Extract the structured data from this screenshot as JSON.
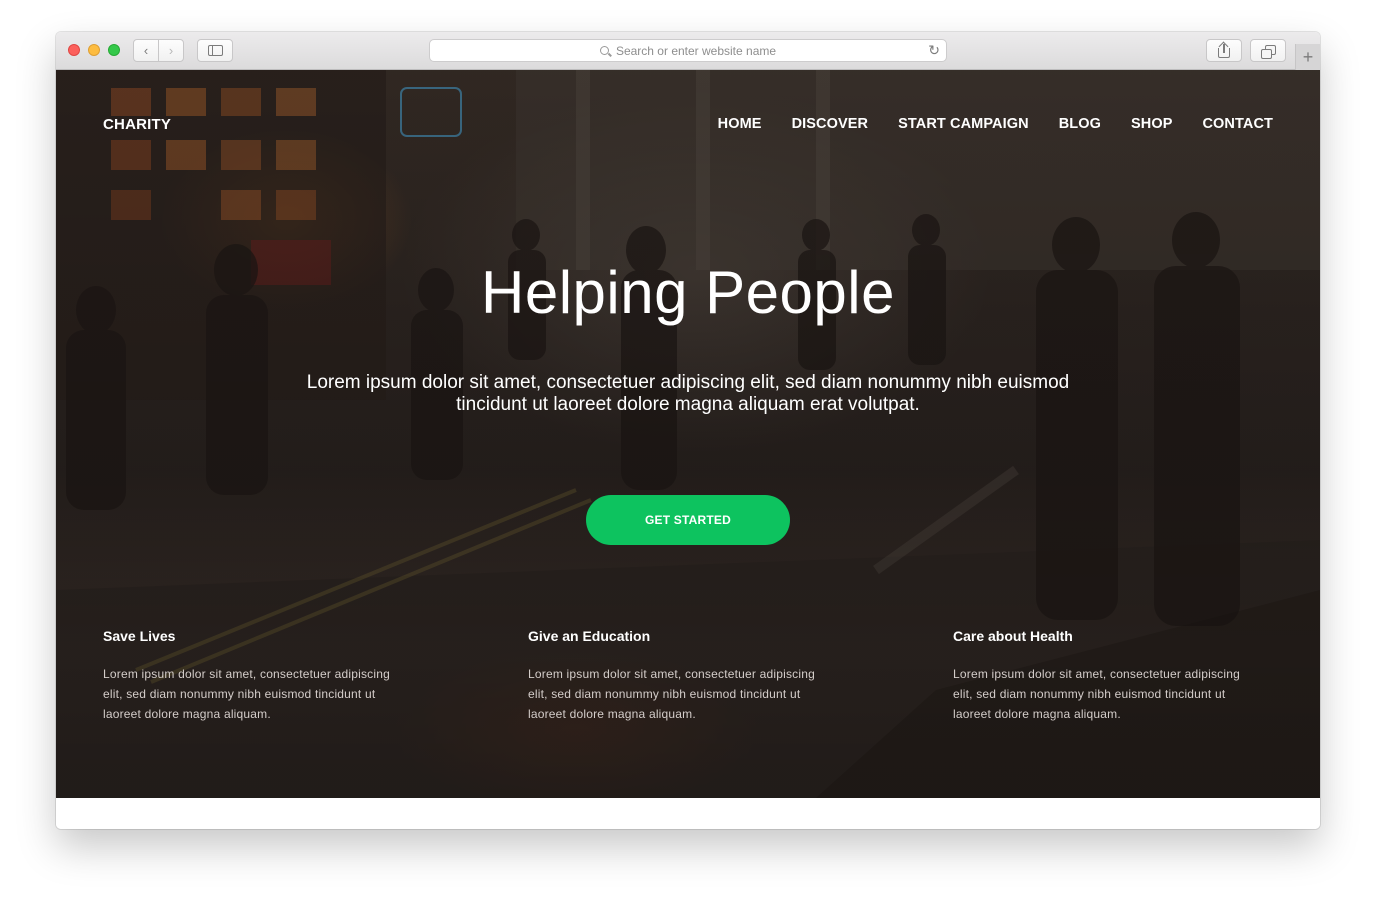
{
  "browser": {
    "address_placeholder": "Search or enter website name",
    "icons": [
      "chevron-left-icon",
      "chevron-right-icon",
      "sidebar-icon",
      "search-icon",
      "reload-icon",
      "share-icon",
      "tabs-icon",
      "plus-icon"
    ]
  },
  "site": {
    "brand": "CHARITY",
    "nav": [
      "HOME",
      "DISCOVER",
      "START CAMPAIGN",
      "BLOG",
      "SHOP",
      "CONTACT"
    ],
    "hero": {
      "title": "Helping People",
      "subtitle": "Lorem ipsum dolor sit amet, consectetuer adipiscing elit, sed diam nonummy nibh euismod tincidunt ut laoreet dolore magna aliquam erat volutpat.",
      "cta": "GET STARTED"
    },
    "features": [
      {
        "title": "Save Lives",
        "text": "Lorem ipsum dolor sit amet, consectetuer adipiscing elit, sed diam nonummy nibh euismod tincidunt ut laoreet dolore magna aliquam."
      },
      {
        "title": "Give an Education",
        "text": "Lorem ipsum dolor sit amet, consectetuer adipiscing elit, sed diam nonummy nibh euismod tincidunt ut laoreet dolore magna aliquam."
      },
      {
        "title": "Care about Health",
        "text": "Lorem ipsum dolor sit amet, consectetuer adipiscing elit, sed diam nonummy nibh euismod tincidunt ut laoreet dolore magna aliquam."
      }
    ]
  },
  "colors": {
    "cta_green": "#0dc35f",
    "traffic_red": "#fc605c",
    "traffic_yellow": "#fdbc40",
    "traffic_green": "#34c84a"
  }
}
